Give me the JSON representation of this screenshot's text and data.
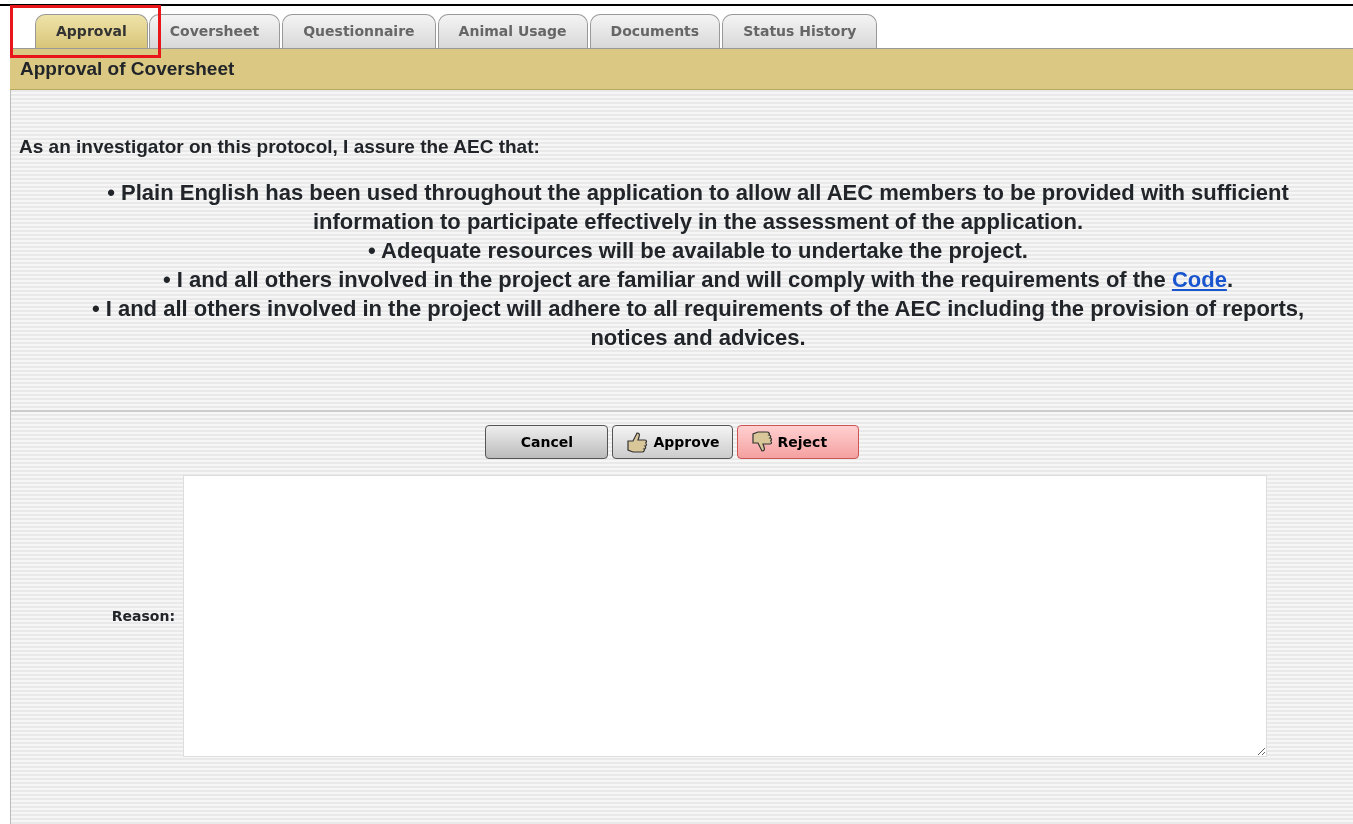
{
  "tabs": [
    {
      "label": "Approval",
      "selected": true,
      "highlighted": true
    },
    {
      "label": "Coversheet",
      "selected": false,
      "highlighted": false
    },
    {
      "label": "Questionnaire",
      "selected": false,
      "highlighted": false
    },
    {
      "label": "Animal Usage",
      "selected": false,
      "highlighted": false
    },
    {
      "label": "Documents",
      "selected": false,
      "highlighted": false
    },
    {
      "label": "Status History",
      "selected": false,
      "highlighted": false
    }
  ],
  "section_title": "Approval of Coversheet",
  "intro": "As an investigator on this protocol, I assure the AEC that:",
  "assurances": [
    {
      "bullet": "•",
      "text": "Plain English has been used throughout the application to allow all AEC members to be provided with sufficient information to participate effectively in the assessment of the application."
    },
    {
      "bullet": "•",
      "text": "Adequate resources will be available to undertake the project."
    },
    {
      "bullet": "•",
      "text": "I and all others involved in the project are familiar and will comply with the requirements of the ",
      "link": "Code",
      "text_after": "."
    },
    {
      "bullet": "•",
      "text": "I and all others involved in the project will adhere to all requirements of the AEC including the provision of reports, notices and advices."
    }
  ],
  "buttons": [
    {
      "label": "Cancel",
      "kind": "cancel"
    },
    {
      "label": "Approve",
      "kind": "approve"
    },
    {
      "label": "Reject",
      "kind": "reject"
    }
  ],
  "reason": {
    "label": "Reason:"
  }
}
